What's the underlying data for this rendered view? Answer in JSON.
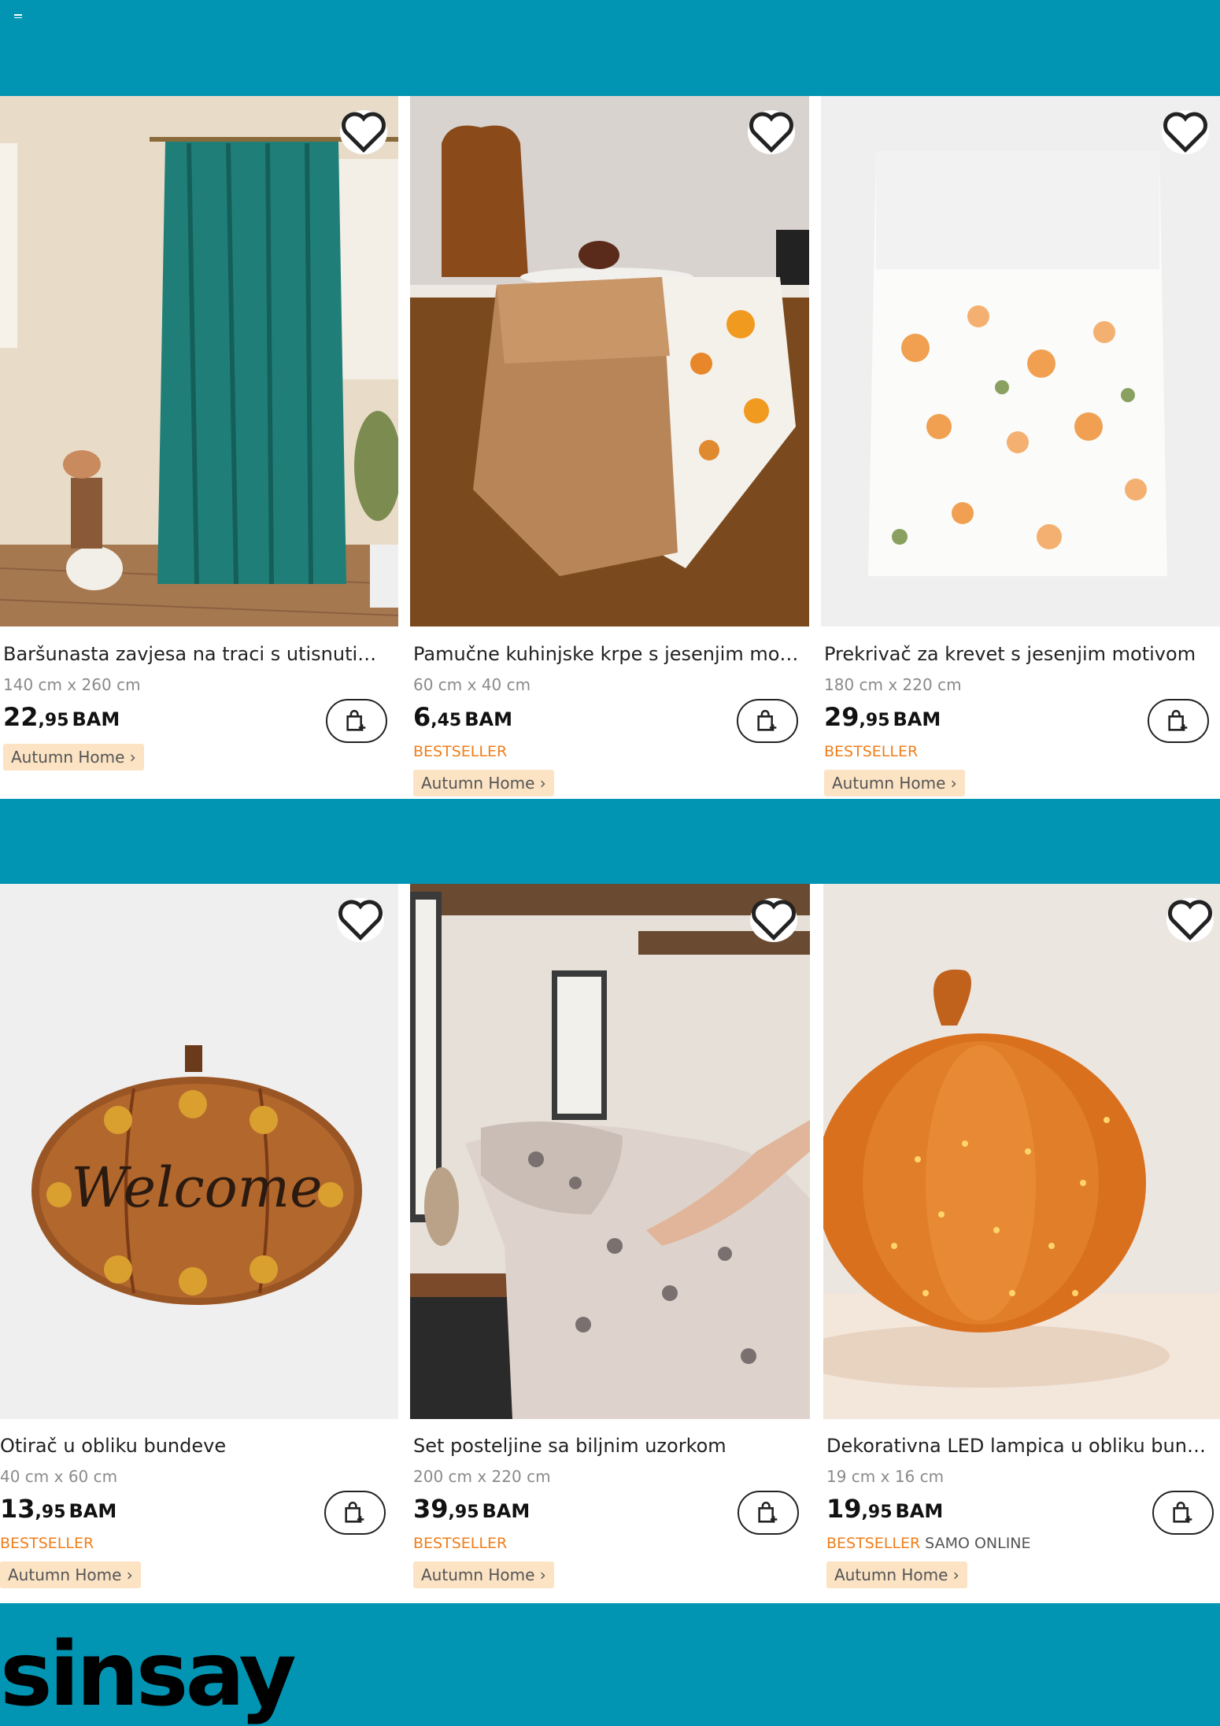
{
  "brand": {
    "logo_text": "sinsay",
    "background_color": "#0195b3"
  },
  "rows": [
    {
      "products": [
        {
          "name": "Baršunasta zavjesa na traci s utisnutim ...",
          "size": "140 cm x 260 cm",
          "price_int": "22",
          "price_dec": ",95",
          "currency": "BAM",
          "badges": [],
          "tag": "Autumn Home ›",
          "image": "teal velvet curtain"
        },
        {
          "name": "Pamučne kuhinjske krpe s jesenjim moti...",
          "size": "60 cm x 40 cm",
          "price_int": "6",
          "price_dec": ",45",
          "currency": "BAM",
          "badges": [
            "BESTSELLER"
          ],
          "tag": "Autumn Home ›",
          "image": "kitchen towels"
        },
        {
          "name": "Prekrivač za krevet s jesenjim motivom",
          "size": "180 cm x 220 cm",
          "price_int": "29",
          "price_dec": ",95",
          "currency": "BAM",
          "badges": [
            "BESTSELLER"
          ],
          "tag": "Autumn Home ›",
          "image": "autumn bedspread"
        }
      ]
    },
    {
      "products": [
        {
          "name": "Otirač u obliku bundeve",
          "size": "40 cm x 60 cm",
          "price_int": "13",
          "price_dec": ",95",
          "currency": "BAM",
          "badges": [
            "BESTSELLER"
          ],
          "tag": "Autumn Home ›",
          "image": "pumpkin doormat",
          "doormat_text": "Welcome"
        },
        {
          "name": "Set posteljine sa biljnim uzorkom",
          "size": "200 cm x 220 cm",
          "price_int": "39",
          "price_dec": ",95",
          "currency": "BAM",
          "badges": [
            "BESTSELLER"
          ],
          "tag": "Autumn Home ›",
          "image": "floral bedding set"
        },
        {
          "name": "Dekorativna LED lampica u obliku bund...",
          "size": "19 cm x 16 cm",
          "price_int": "19",
          "price_dec": ",95",
          "currency": "BAM",
          "badges": [
            "BESTSELLER",
            "SAMO ONLINE"
          ],
          "tag": "Autumn Home ›",
          "image": "glass pumpkin led lamp"
        }
      ]
    }
  ],
  "icons": {
    "menu": "menu-icon",
    "wishlist": "heart-icon",
    "cart": "add-to-cart-icon"
  }
}
